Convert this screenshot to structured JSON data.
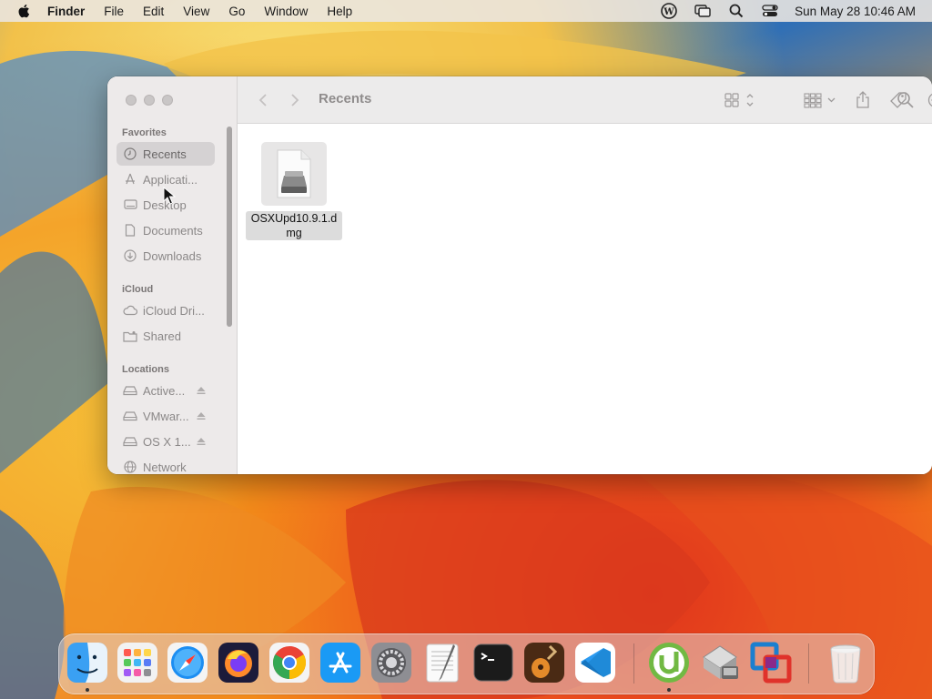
{
  "menubar": {
    "app_name": "Finder",
    "items": [
      "File",
      "Edit",
      "View",
      "Go",
      "Window",
      "Help"
    ],
    "clock": "Sun May 28  10:46 AM"
  },
  "window": {
    "title": "Recents",
    "sidebar": {
      "favorites_header": "Favorites",
      "favorites": [
        "Recents",
        "Applicati...",
        "Desktop",
        "Documents",
        "Downloads"
      ],
      "icloud_header": "iCloud",
      "icloud": [
        "iCloud Dri...",
        "Shared"
      ],
      "locations_header": "Locations",
      "locations": [
        "Active...",
        "VMwar...",
        "OS X 1...",
        "Network"
      ]
    },
    "file": {
      "name": "OSXUpd10.9.1.dmg"
    }
  },
  "dock": {
    "apps": [
      "Finder",
      "Launchpad",
      "Safari",
      "Firefox",
      "Google Chrome",
      "App Store",
      "System Settings",
      "TextEdit",
      "Terminal",
      "GarageBand",
      "Visual Studio Code",
      "uTorrent",
      "Boot Camp Assistant",
      "VMware Fusion",
      "Trash"
    ]
  },
  "colors": {
    "accent": "#2f6fb6",
    "sidebar_bg": "#ece9e9",
    "selection_bg": "#d5d2d3"
  }
}
